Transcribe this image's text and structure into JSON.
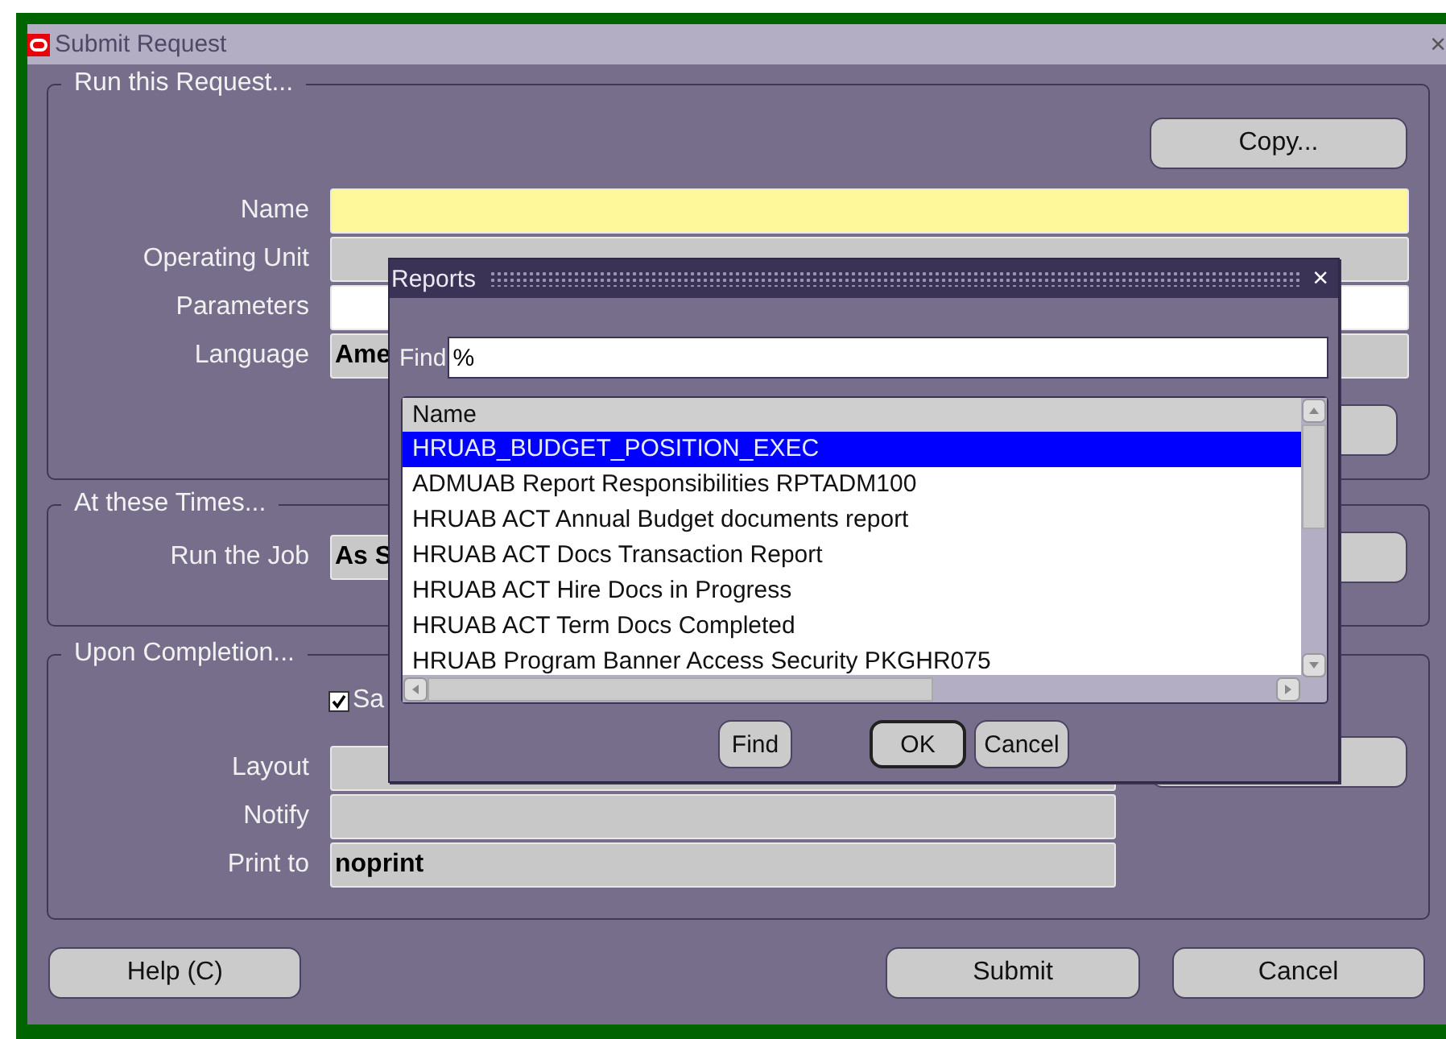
{
  "window": {
    "title": "Submit Request",
    "close": "×"
  },
  "run_request": {
    "legend": "Run this Request...",
    "copy_button": {
      "label": "Copy..."
    },
    "fields": [
      {
        "label": "Name",
        "kind": "required"
      },
      {
        "label": "Operating Unit",
        "kind": "readonly"
      },
      {
        "label": "Parameters",
        "kind": "editable"
      },
      {
        "label": "Language",
        "kind": "readonly",
        "value": "Ame"
      }
    ]
  },
  "schedule": {
    "legend": "At these Times...",
    "fields": [
      {
        "label": "Run the Job",
        "kind": "readonly",
        "value": "As S"
      }
    ]
  },
  "completion": {
    "legend": "Upon Completion...",
    "checkbox": {
      "label": "Sa",
      "checked": true
    },
    "fields": [
      {
        "label": "Layout",
        "kind": "readonly"
      },
      {
        "label": "Notify",
        "kind": "readonly"
      },
      {
        "label": "Print to",
        "kind": "readonly",
        "value": "noprint"
      }
    ]
  },
  "buttons": [
    {
      "label": "Help (C)"
    },
    {
      "label": "Submit"
    },
    {
      "label": "Cancel"
    }
  ],
  "dialog": {
    "title": "Reports",
    "close": "×",
    "find_label": "Find",
    "find_value": "%",
    "column": "Name",
    "rows": [
      {
        "name": "HRUAB_BUDGET_POSITION_EXEC",
        "selected": true
      },
      {
        "name": "ADMUAB Report Responsibilities RPTADM100",
        "selected": false
      },
      {
        "name": "HRUAB ACT Annual Budget documents report",
        "selected": false
      },
      {
        "name": "HRUAB ACT Docs Transaction Report",
        "selected": false
      },
      {
        "name": "HRUAB ACT Hire Docs in Progress",
        "selected": false
      },
      {
        "name": "HRUAB ACT Term Docs Completed",
        "selected": false
      },
      {
        "name": "HRUAB Program Banner Access Security PKGHR075",
        "selected": false
      }
    ],
    "buttons": [
      {
        "label": "Find",
        "default": false
      },
      {
        "label": "OK",
        "default": true
      },
      {
        "label": "Cancel",
        "default": false
      }
    ]
  }
}
